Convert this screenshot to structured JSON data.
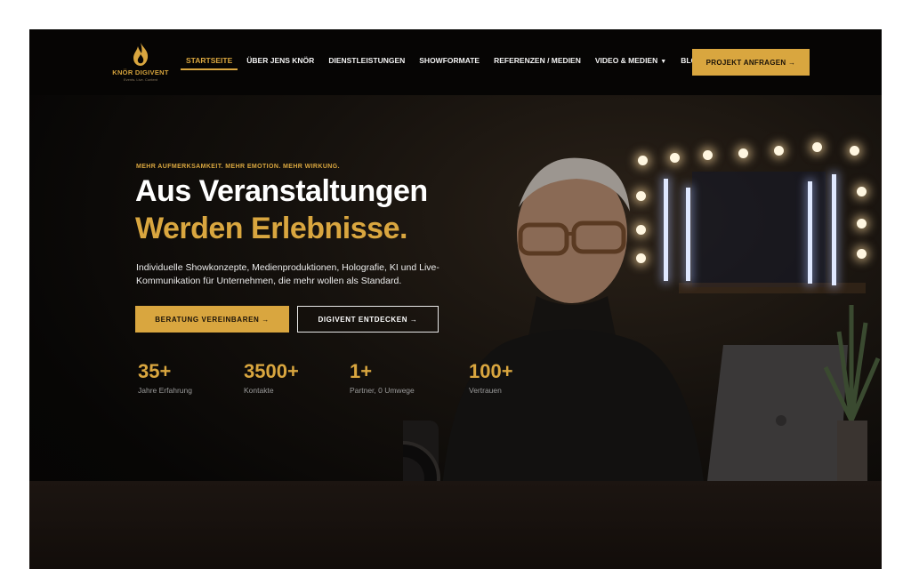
{
  "brand": {
    "name": "KNÖR DIGIVENT",
    "tagline": "Events. Live. Content",
    "accent": "#d9a63f",
    "logo_icon": "flame-icon"
  },
  "nav": {
    "items": [
      {
        "label": "STARTSEITE",
        "active": true
      },
      {
        "label": "ÜBER JENS KNÖR"
      },
      {
        "label": "DIENSTLEISTUNGEN"
      },
      {
        "label": "SHOWFORMATE"
      },
      {
        "label": "REFERENZEN / MEDIEN"
      },
      {
        "label": "VIDEO & MEDIEN",
        "dropdown": true
      },
      {
        "label": "BLOG",
        "dropdown": true
      }
    ],
    "cta": "PROJEKT ANFRAGEN →"
  },
  "hero": {
    "eyebrow": "MEHR AUFMERKSAMKEIT. MEHR EMOTION. MEHR WIRKUNG.",
    "title_line1": "Aus Veranstaltungen",
    "title_line2": "Werden Erlebnisse.",
    "description": "Individuelle Showkonzepte, Medienproduktionen, Holografie, KI und Live-Kommunikation für Unternehmen, die mehr wollen als Standard.",
    "primary_button": "BERATUNG VEREINBAREN →",
    "secondary_button": "DIGIVENT ENTDECKEN →"
  },
  "stats": [
    {
      "value": "35+",
      "label": "Jahre Erfahrung"
    },
    {
      "value": "3500+",
      "label": "Kontakte"
    },
    {
      "value": "1+",
      "label": "Partner, 0 Umwege"
    },
    {
      "value": "100+",
      "label": "Vertrauen"
    }
  ]
}
